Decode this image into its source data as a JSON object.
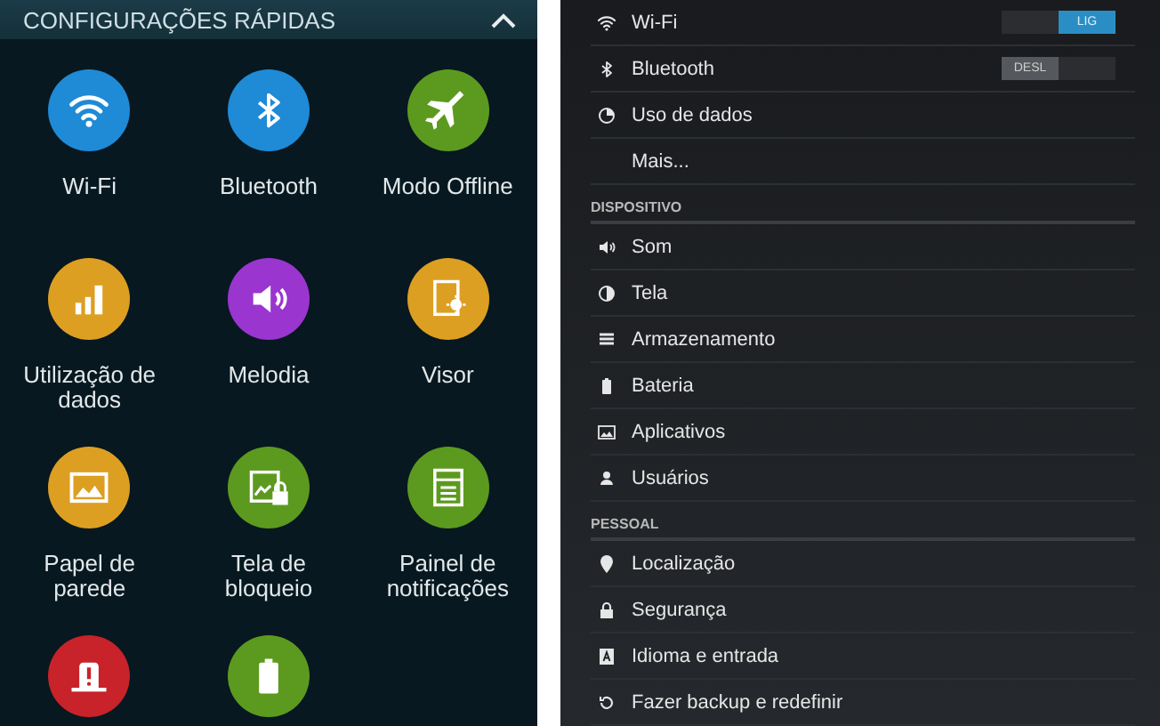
{
  "quick_settings": {
    "title": "CONFIGURAÇÕES RÁPIDAS",
    "tiles": [
      {
        "label": "Wi-Fi",
        "color": "#1f8ad6"
      },
      {
        "label": "Bluetooth",
        "color": "#1f8ad6"
      },
      {
        "label": "Modo Offline",
        "color": "#5c9a1f"
      },
      {
        "label": "Utilização de\ndados",
        "color": "#dd9f22"
      },
      {
        "label": "Melodia",
        "color": "#9a35cf"
      },
      {
        "label": "Visor",
        "color": "#dd9f22"
      },
      {
        "label": "Papel de\nparede",
        "color": "#dd9f22"
      },
      {
        "label": "Tela de\nbloqueio",
        "color": "#5c9a1f"
      },
      {
        "label": "Painel de\nnotificações",
        "color": "#5c9a1f"
      },
      {
        "color": "#c8222a"
      },
      {
        "color": "#5c9a1f"
      }
    ]
  },
  "settings": {
    "rows": [
      {
        "kind": "item",
        "label": "Wi-Fi",
        "toggle": {
          "on": true,
          "label": "LIG"
        }
      },
      {
        "kind": "item",
        "label": "Bluetooth",
        "toggle": {
          "on": false,
          "label": "DESL"
        }
      },
      {
        "kind": "item",
        "label": "Uso de dados"
      },
      {
        "kind": "item",
        "label": "Mais..."
      },
      {
        "kind": "header",
        "label": "DISPOSITIVO"
      },
      {
        "kind": "item",
        "label": "Som"
      },
      {
        "kind": "item",
        "label": "Tela"
      },
      {
        "kind": "item",
        "label": "Armazenamento"
      },
      {
        "kind": "item",
        "label": "Bateria"
      },
      {
        "kind": "item",
        "label": "Aplicativos"
      },
      {
        "kind": "item",
        "label": "Usuários"
      },
      {
        "kind": "header",
        "label": "PESSOAL"
      },
      {
        "kind": "item",
        "label": "Localização"
      },
      {
        "kind": "item",
        "label": "Segurança"
      },
      {
        "kind": "item",
        "label": "Idioma e entrada"
      },
      {
        "kind": "item",
        "label": "Fazer backup e redefinir"
      }
    ]
  }
}
